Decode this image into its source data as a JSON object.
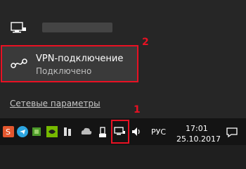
{
  "flyout": {
    "vpn_connection": {
      "name": "VPN-подключение",
      "status": "Подключено"
    },
    "settings_link": "Сетевые параметры",
    "annotations": {
      "marker_2": "2",
      "marker_1": "1"
    }
  },
  "taskbar": {
    "language": "РУС",
    "time": "17:01",
    "date": "25.10.2017",
    "accent_color": "#e81123"
  }
}
